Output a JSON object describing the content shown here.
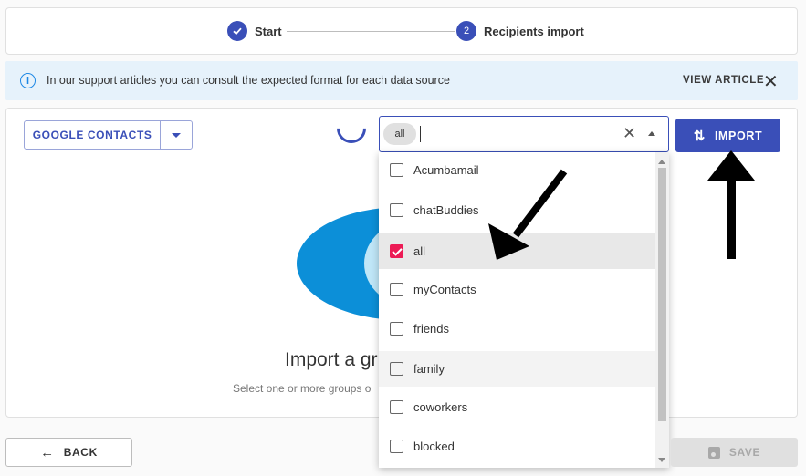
{
  "stepper": {
    "steps": [
      {
        "label": "Start",
        "status": "completed",
        "icon": "check-icon"
      },
      {
        "label": "Recipients import",
        "status": "active",
        "number": "2"
      }
    ]
  },
  "info_banner": {
    "text": "In our support articles you can consult the expected format for each data source",
    "link_label": "VIEW ARTICLE",
    "icon": "info-icon",
    "close_icon": "close-icon"
  },
  "source": {
    "label": "GOOGLE CONTACTS",
    "caret_icon": "caret-down-icon"
  },
  "import_button": {
    "label": "IMPORT",
    "icon": "swap-vert-icon"
  },
  "groups_select": {
    "selected_chip": "all",
    "input_value": "",
    "clear_icon": "close-icon",
    "toggle_icon": "caret-up-icon",
    "options": [
      {
        "label": "Acumbamail",
        "checked": false
      },
      {
        "label": "chatBuddies",
        "checked": false
      },
      {
        "label": "all",
        "checked": true
      },
      {
        "label": "myContacts",
        "checked": false
      },
      {
        "label": "friends",
        "checked": false
      },
      {
        "label": "family",
        "checked": false
      },
      {
        "label": "coworkers",
        "checked": false
      },
      {
        "label": "blocked",
        "checked": false
      }
    ]
  },
  "empty_state": {
    "title": "Import a gr",
    "subtitle": "Select one or more groups o"
  },
  "footer": {
    "back_label": "BACK",
    "save_label": "SAVE",
    "save_disabled": true
  },
  "colors": {
    "primary": "#3a4fb8",
    "checkbox_checked": "#ec1b55",
    "banner_bg": "#e6f2fb",
    "illustration": "#0c8fd8"
  }
}
